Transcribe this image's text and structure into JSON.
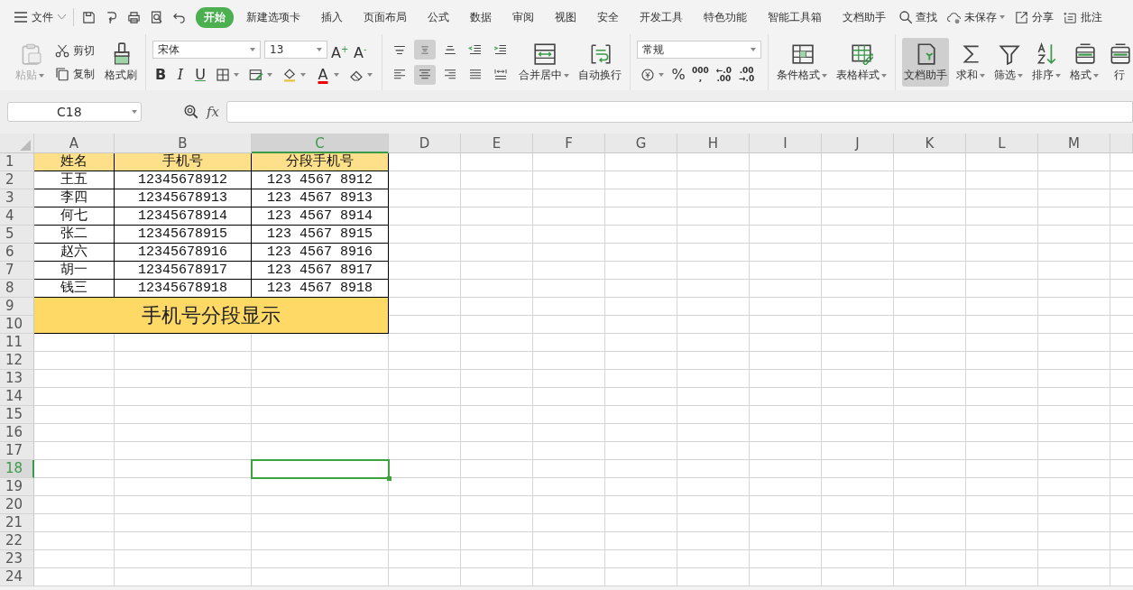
{
  "menu": {
    "label": "文件"
  },
  "tabs": [
    {
      "label": "开始",
      "selected": true
    },
    {
      "label": "新建选项卡",
      "selected": false
    },
    {
      "label": "插入",
      "selected": false
    },
    {
      "label": "页面布局",
      "selected": false
    },
    {
      "label": "公式",
      "selected": false
    },
    {
      "label": "数据",
      "selected": false
    },
    {
      "label": "审阅",
      "selected": false
    },
    {
      "label": "视图",
      "selected": false
    },
    {
      "label": "安全",
      "selected": false
    },
    {
      "label": "开发工具",
      "selected": false
    },
    {
      "label": "特色功能",
      "selected": false
    },
    {
      "label": "智能工具箱",
      "selected": false
    },
    {
      "label": "文档助手",
      "selected": false
    }
  ],
  "search": {
    "label": "查找"
  },
  "actions": [
    {
      "kind": "cloud",
      "label": "未保存",
      "dropdown": true
    },
    {
      "kind": "share",
      "label": "分享",
      "dropdown": false
    },
    {
      "kind": "comment",
      "label": "批注",
      "dropdown": false
    }
  ],
  "ribbon": {
    "paste": {
      "label": "粘贴",
      "disabled": true
    },
    "cut": {
      "label": "剪切"
    },
    "copy": {
      "label": "复制"
    },
    "format_painter": {
      "label": "格式刷"
    },
    "font": {
      "family": "宋体",
      "size": "13"
    },
    "font_buttons": [
      {
        "label": "A$^{+}$"
      },
      {
        "label": "A$^{-}$"
      }
    ],
    "style_buttons": [
      {
        "kind": "bold",
        "label": "B"
      },
      {
        "kind": "italic",
        "label": "I"
      },
      {
        "kind": "underline",
        "label": "U"
      },
      {
        "kind": "borders"
      },
      {
        "kind": "cell_style"
      },
      {
        "kind": "fill"
      },
      {
        "kind": "font_color",
        "label": "A"
      },
      {
        "kind": "clear"
      }
    ],
    "align_top": [
      {
        "kind": "top",
        "selected": false
      },
      {
        "kind": "middle",
        "selected": true
      },
      {
        "kind": "bottom",
        "selected": false
      },
      {
        "kind": "outdent",
        "selected": false
      },
      {
        "kind": "indent",
        "selected": false
      }
    ],
    "align_bottom": [
      {
        "kind": "left",
        "selected": false
      },
      {
        "kind": "center",
        "selected": true
      },
      {
        "kind": "right",
        "selected": false
      },
      {
        "kind": "justify",
        "selected": false
      },
      {
        "kind": "distributed",
        "selected": false
      }
    ],
    "merge": {
      "label": "合并居中"
    },
    "wrap": {
      "label": "自动换行"
    },
    "number_format": "常规",
    "number_buttons": [
      {
        "kind": "currency"
      },
      {
        "kind": "percent",
        "label": "%"
      },
      {
        "kind": "thousands",
        "lines": [
          "000",
          ","
        ]
      },
      {
        "kind": "increase_decimal",
        "lines": [
          "←.0",
          ".00"
        ]
      },
      {
        "kind": "decrease_decimal",
        "lines": [
          ".00",
          "→.0"
        ]
      }
    ],
    "styles": [
      {
        "kind": "conditional",
        "label": "条件格式",
        "dropdown": true,
        "pressed": false
      },
      {
        "kind": "table_style",
        "label": "表格样式",
        "dropdown": true,
        "pressed": false
      }
    ],
    "tools": [
      {
        "kind": "doc_helper",
        "label": "文档助手",
        "dropdown": false,
        "pressed": true
      },
      {
        "kind": "sum",
        "label": "求和",
        "dropdown": true,
        "pressed": false
      },
      {
        "kind": "filter",
        "label": "筛选",
        "dropdown": true,
        "pressed": false
      },
      {
        "kind": "sort",
        "label": "排序",
        "dropdown": true,
        "pressed": false
      },
      {
        "kind": "format",
        "label": "格式",
        "dropdown": true,
        "pressed": false
      },
      {
        "kind": "row",
        "label": "行",
        "dropdown": false,
        "pressed": false
      }
    ]
  },
  "formula_bar": {
    "name_box": "C18",
    "fx": "fx"
  },
  "sheet": {
    "columns": [
      {
        "label": "A",
        "selected": false
      },
      {
        "label": "B",
        "selected": false
      },
      {
        "label": "C",
        "selected": true
      },
      {
        "label": "D",
        "selected": false
      },
      {
        "label": "E",
        "selected": false
      },
      {
        "label": "F",
        "selected": false
      },
      {
        "label": "G",
        "selected": false
      },
      {
        "label": "H",
        "selected": false
      },
      {
        "label": "I",
        "selected": false
      },
      {
        "label": "J",
        "selected": false
      },
      {
        "label": "K",
        "selected": false
      },
      {
        "label": "L",
        "selected": false
      },
      {
        "label": "M",
        "selected": false
      }
    ],
    "rows": [
      {
        "label": "1",
        "selected": false,
        "kind": "header",
        "cells": [
          "姓名",
          "手机号",
          "分段手机号"
        ]
      },
      {
        "label": "2",
        "selected": false,
        "kind": "data",
        "cells": [
          "王五",
          "12345678912",
          "123 4567 8912"
        ]
      },
      {
        "label": "3",
        "selected": false,
        "kind": "data",
        "cells": [
          "李四",
          "12345678913",
          "123 4567 8913"
        ]
      },
      {
        "label": "4",
        "selected": false,
        "kind": "data",
        "cells": [
          "何七",
          "12345678914",
          "123 4567 8914"
        ]
      },
      {
        "label": "5",
        "selected": false,
        "kind": "data",
        "cells": [
          "张二",
          "12345678915",
          "123 4567 8915"
        ]
      },
      {
        "label": "6",
        "selected": false,
        "kind": "data",
        "cells": [
          "赵六",
          "12345678916",
          "123 4567 8916"
        ]
      },
      {
        "label": "7",
        "selected": false,
        "kind": "data",
        "cells": [
          "胡一",
          "12345678917",
          "123 4567 8917"
        ]
      },
      {
        "label": "8",
        "selected": false,
        "kind": "data",
        "cells": [
          "钱三",
          "12345678918",
          "123 4567 8918"
        ]
      },
      {
        "label": "9",
        "selected": false,
        "kind": "banner",
        "text": "手机号分段显示"
      },
      {
        "label": "10",
        "selected": false,
        "kind": "merged"
      },
      {
        "label": "11",
        "selected": false,
        "kind": "empty"
      },
      {
        "label": "12",
        "selected": false,
        "kind": "empty"
      },
      {
        "label": "13",
        "selected": false,
        "kind": "empty"
      },
      {
        "label": "14",
        "selected": false,
        "kind": "empty"
      },
      {
        "label": "15",
        "selected": false,
        "kind": "empty"
      },
      {
        "label": "16",
        "selected": false,
        "kind": "empty"
      },
      {
        "label": "17",
        "selected": false,
        "kind": "empty"
      },
      {
        "label": "18",
        "selected": true,
        "kind": "empty"
      },
      {
        "label": "19",
        "selected": false,
        "kind": "empty"
      },
      {
        "label": "20",
        "selected": false,
        "kind": "empty"
      },
      {
        "label": "21",
        "selected": false,
        "kind": "empty"
      },
      {
        "label": "22",
        "selected": false,
        "kind": "empty"
      },
      {
        "label": "23",
        "selected": false,
        "kind": "empty"
      },
      {
        "label": "24",
        "selected": false,
        "kind": "empty"
      }
    ]
  }
}
